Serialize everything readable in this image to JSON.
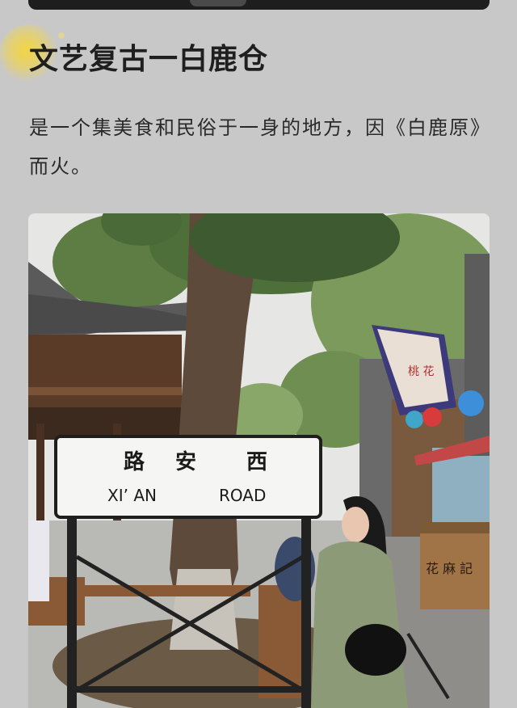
{
  "article": {
    "title": "文艺复古一白鹿仓",
    "paragraph": "是一个集美食和民俗于一身的地方，因《白鹿原》而火。"
  },
  "photo": {
    "sign_cn": [
      "路",
      "安",
      "西"
    ],
    "sign_en_left": "XI’ AN",
    "sign_en_right": "ROAD",
    "banner_text": "桃 花",
    "stall_text": "花 麻 記"
  },
  "colors": {
    "page_bg": "#c8c8c8",
    "title": "#1f1f1f",
    "accent_deco": "#f5d63c"
  }
}
